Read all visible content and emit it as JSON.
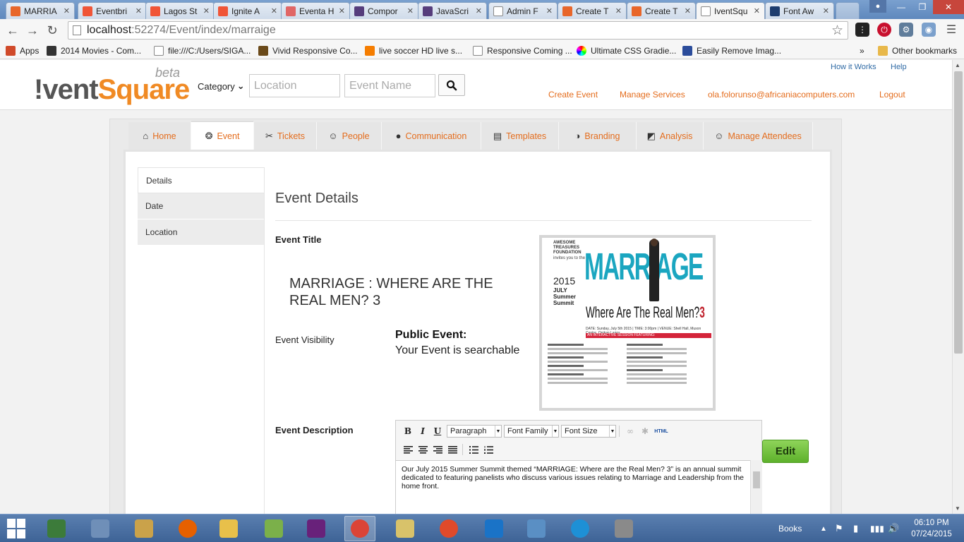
{
  "browser": {
    "tabs": [
      {
        "label": "MARRIA",
        "favicon": "orange-circle-icon",
        "color": "#e8662a"
      },
      {
        "label": "Eventbri",
        "favicon": "eventbrite-icon",
        "color": "#f05537"
      },
      {
        "label": "Lagos St",
        "favicon": "eventbrite-icon",
        "color": "#f05537"
      },
      {
        "label": "Ignite A",
        "favicon": "eventbrite-icon",
        "color": "#f05537"
      },
      {
        "label": "Eventa H",
        "favicon": "eventa-icon",
        "color": "#e06666"
      },
      {
        "label": "Compor",
        "favicon": "bootstrap-icon",
        "color": "#563d7c"
      },
      {
        "label": "JavaScri",
        "favicon": "bootstrap-icon",
        "color": "#563d7c"
      },
      {
        "label": "Admin F",
        "favicon": "page-icon",
        "color": "#ffffff"
      },
      {
        "label": "Create T",
        "favicon": "orange-circle-icon",
        "color": "#e8662a"
      },
      {
        "label": "Create T",
        "favicon": "orange-circle-icon",
        "color": "#e8662a"
      },
      {
        "label": "IventSqu",
        "favicon": "page-icon",
        "color": "#ffffff",
        "active": true
      },
      {
        "label": "Font Aw",
        "favicon": "flag-icon",
        "color": "#1d3c6e"
      }
    ],
    "url_host": "localhost",
    "url_path": ":52274/Event/index/marraige",
    "bookmarks": [
      {
        "label": "Apps",
        "icon": "apps-grid-icon"
      },
      {
        "label": "2014 Movies - Com...",
        "icon": "movies-icon"
      },
      {
        "label": "file:///C:/Users/SIGA...",
        "icon": "page-icon"
      },
      {
        "label": "Vivid Responsive Co...",
        "icon": "vivid-icon"
      },
      {
        "label": "live soccer HD live s...",
        "icon": "blogger-icon"
      },
      {
        "label": "Responsive Coming ...",
        "icon": "page-icon"
      },
      {
        "label": "Ultimate CSS Gradie...",
        "icon": "gradient-icon"
      },
      {
        "label": "Easily Remove Imag...",
        "icon": "checker-icon"
      }
    ],
    "bookmarks_more": "»",
    "other_bookmarks": "Other bookmarks"
  },
  "site": {
    "logo_prefix": "!vent",
    "logo_suffix": "Square",
    "logo_beta": "beta",
    "category_label": "Category",
    "location_placeholder": "Location",
    "event_name_placeholder": "Event Name",
    "top_links": {
      "how": "How it Works",
      "help": "Help"
    },
    "nav_links": {
      "create": "Create Event",
      "manage": "Manage Services",
      "email": "ola.folorunso@africaniacomputers.com",
      "logout": "Logout"
    },
    "tabs": [
      {
        "label": "Home",
        "icon": "home-icon"
      },
      {
        "label": "Event",
        "icon": "award-icon",
        "active": true
      },
      {
        "label": "Tickets",
        "icon": "ticket-icon"
      },
      {
        "label": "People",
        "icon": "people-icon"
      },
      {
        "label": "Communication",
        "icon": "chat-icon"
      },
      {
        "label": "Templates",
        "icon": "copy-icon"
      },
      {
        "label": "Branding",
        "icon": "palette-icon"
      },
      {
        "label": "Analysis",
        "icon": "chart-icon"
      },
      {
        "label": "Manage Attendees",
        "icon": "people-icon"
      }
    ],
    "side_menu": [
      {
        "label": "Details",
        "active": true
      },
      {
        "label": "Date"
      },
      {
        "label": "Location"
      }
    ]
  },
  "details": {
    "section_title": "Event Details",
    "title_label": "Event Title",
    "title_value": "MARRIAGE : WHERE ARE THE REAL MEN? 3",
    "visibility_label": "Event Visibility",
    "visibility_head": "Public Event:",
    "visibility_sub": "Your Event is searchable",
    "description_label": "Event Description",
    "description_text": "Our July 2015 Summer Summit themed “MARRIAGE: Where are the Real Men? 3” is an annual summit dedicated to featuring panelists who discuss various issues relating to Marriage and Leadership from the home front.",
    "edit_button": "Edit"
  },
  "poster": {
    "org": "AWESOME TREASURES FOUNDATION",
    "invite": "invites you to the",
    "year": "2015",
    "summit": "JULY Summer Summit",
    "title": "MARRIAGE",
    "subtitle": "Where Are The Real Men?",
    "number": "3",
    "date_line": "DATE: Sunday, July 5th 2015 | TIME: 3:00pm | VENUE: Shell Hall, Muson Centre, Onikan Lagos",
    "band": "AN INTERACTIVE SESSION FEATURING:"
  },
  "editor": {
    "format_select": "Paragraph",
    "font_family_select": "Font Family",
    "font_size_select": "Font Size",
    "bold": "B",
    "italic": "I",
    "underline": "U",
    "html": "HTML"
  },
  "taskbar": {
    "books_label": "Books",
    "time": "06:10 PM",
    "date": "07/24/2015",
    "apps": [
      {
        "name": "calculator-grid-icon",
        "color": "#3c7b3a"
      },
      {
        "name": "window-icon",
        "color": "#6f8fb8"
      },
      {
        "name": "paint-icon",
        "color": "#caa24a"
      },
      {
        "name": "firefox-icon",
        "color": "#e66000"
      },
      {
        "name": "explorer-folder-icon",
        "color": "#e8c04a"
      },
      {
        "name": "notepad-plus-icon",
        "color": "#7bb04a"
      },
      {
        "name": "visual-studio-icon",
        "color": "#68217a"
      },
      {
        "name": "chrome-icon",
        "color": "#db4437",
        "active": true
      },
      {
        "name": "folder-icon",
        "color": "#d8c26a"
      },
      {
        "name": "headphones-icon",
        "color": "#e04a2a"
      },
      {
        "name": "mail-icon",
        "color": "#1a73c7"
      },
      {
        "name": "control-panel-icon",
        "color": "#5a8fc4"
      },
      {
        "name": "internet-explorer-icon",
        "color": "#1e90d6"
      },
      {
        "name": "tools-icon",
        "color": "#8a8a8a"
      }
    ]
  }
}
